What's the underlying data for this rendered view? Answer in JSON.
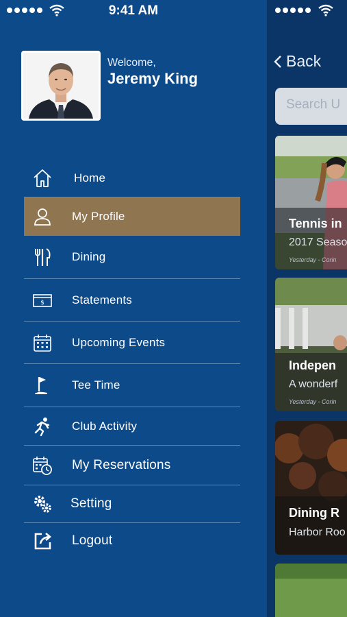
{
  "status_bar": {
    "time": "9:41 AM"
  },
  "profile": {
    "welcome": "Welcome,",
    "name": "Jeremy King"
  },
  "menu": {
    "items": [
      {
        "label": "Home",
        "icon": "home-icon"
      },
      {
        "label": "My Profile",
        "icon": "person-icon",
        "active": true
      },
      {
        "label": "Dining",
        "icon": "dining-icon"
      },
      {
        "label": "Statements",
        "icon": "statement-icon"
      },
      {
        "label": "Upcoming Events",
        "icon": "calendar-icon"
      },
      {
        "label": "Tee Time",
        "icon": "golf-flag-icon"
      },
      {
        "label": "Club Activity",
        "icon": "runner-icon"
      },
      {
        "label": "My Reservations",
        "icon": "calendar-clock-icon"
      },
      {
        "label": "Setting",
        "icon": "gears-icon"
      },
      {
        "label": "Logout",
        "icon": "logout-icon"
      }
    ]
  },
  "behind": {
    "back_label": "Back",
    "search_placeholder": "Search U",
    "cards": [
      {
        "title": "Tennis in",
        "subtitle": "2017 Seaso",
        "meta": "Yesterday - Corin"
      },
      {
        "title": "Indepen",
        "subtitle": "A wonderf",
        "meta": "Yesterday - Corin"
      },
      {
        "title": "Dining R",
        "subtitle": "Harbor Roo"
      }
    ]
  },
  "colors": {
    "drawer_bg": "#0c4a8a",
    "active_item": "#8f7651",
    "behind_bg": "#0a3566"
  }
}
